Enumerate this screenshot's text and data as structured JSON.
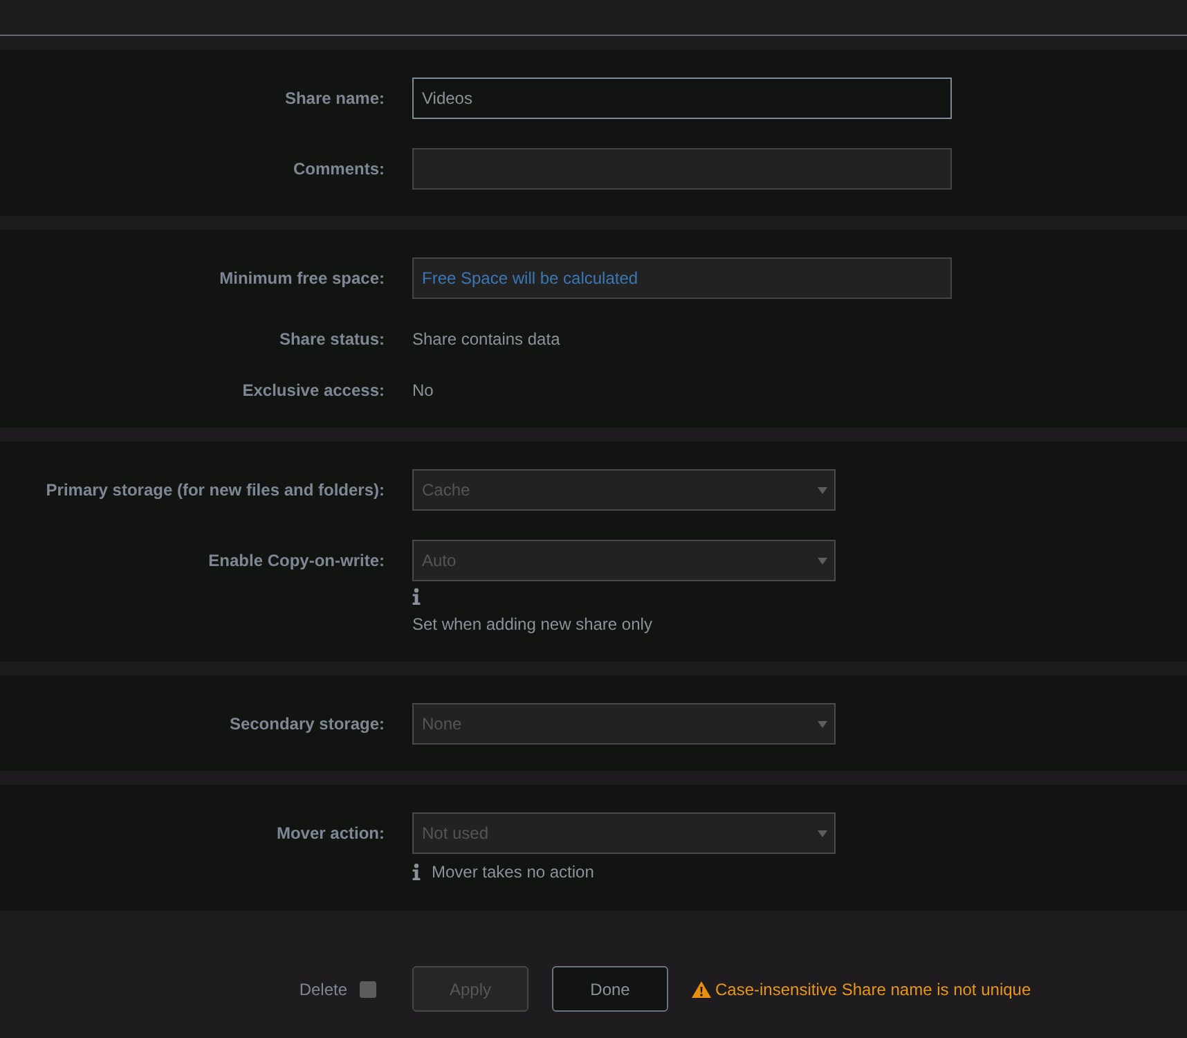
{
  "sections": [
    {
      "rows": [
        {
          "kind": "input",
          "label": "Share name:",
          "value": "Videos",
          "focused": true
        },
        {
          "kind": "input",
          "label": "Comments:",
          "focused": false
        }
      ]
    },
    {
      "rows": [
        {
          "kind": "input",
          "label": "Minimum free space:",
          "placeholder": "Free Space will be calculated",
          "focused": false
        },
        {
          "kind": "text",
          "label": "Share status:",
          "value": "Share contains data"
        },
        {
          "kind": "text",
          "label": "Exclusive access:",
          "value": "No"
        }
      ]
    },
    {
      "rows": [
        {
          "kind": "select",
          "label": "Primary storage (for new files and folders):",
          "value": "Cache",
          "disabled": true
        },
        {
          "kind": "select",
          "label": "Enable Copy-on-write:",
          "value": "Auto",
          "disabled": true,
          "help": {
            "kind": "block",
            "text": "Set when adding new share only"
          }
        }
      ]
    },
    {
      "rows": [
        {
          "kind": "select",
          "label": "Secondary storage:",
          "value": "None",
          "disabled": true
        }
      ]
    },
    {
      "rows": [
        {
          "kind": "select",
          "label": "Mover action:",
          "value": "Not used",
          "disabled": true,
          "help": {
            "kind": "inline",
            "text": "Mover takes no action"
          }
        }
      ]
    }
  ],
  "footer": {
    "delete": {
      "label": "Delete",
      "checked": false
    },
    "buttons": [
      {
        "label": "Apply",
        "disabled": true
      },
      {
        "label": "Done",
        "disabled": false
      }
    ],
    "warning": "Case-insensitive Share name is not unique"
  }
}
